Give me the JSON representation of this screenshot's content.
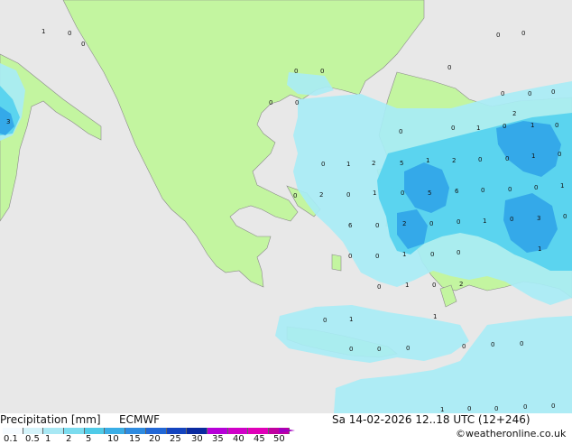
{
  "map": {
    "value_labels": [
      {
        "text": "1"
      },
      {
        "text": "0"
      },
      {
        "text": "0"
      },
      {
        "text": "0"
      },
      {
        "text": "0"
      },
      {
        "text": "0"
      },
      {
        "text": "0"
      },
      {
        "text": "0"
      },
      {
        "text": "0"
      },
      {
        "text": "3"
      },
      {
        "text": "0"
      },
      {
        "text": "0"
      },
      {
        "text": "0"
      },
      {
        "text": "0"
      },
      {
        "text": "0"
      },
      {
        "text": "0"
      },
      {
        "text": "1"
      },
      {
        "text": "0"
      },
      {
        "text": "1"
      },
      {
        "text": "0"
      },
      {
        "text": "2"
      },
      {
        "text": "0"
      },
      {
        "text": "1"
      },
      {
        "text": "2"
      },
      {
        "text": "5"
      },
      {
        "text": "1"
      },
      {
        "text": "2"
      },
      {
        "text": "0"
      },
      {
        "text": "0"
      },
      {
        "text": "1"
      },
      {
        "text": "0"
      },
      {
        "text": "0"
      },
      {
        "text": "2"
      },
      {
        "text": "0"
      },
      {
        "text": "1"
      },
      {
        "text": "0"
      },
      {
        "text": "5"
      },
      {
        "text": "6"
      },
      {
        "text": "0"
      },
      {
        "text": "0"
      },
      {
        "text": "0"
      },
      {
        "text": "1"
      },
      {
        "text": "6"
      },
      {
        "text": "0"
      },
      {
        "text": "2"
      },
      {
        "text": "0"
      },
      {
        "text": "0"
      },
      {
        "text": "1"
      },
      {
        "text": "0"
      },
      {
        "text": "3"
      },
      {
        "text": "0"
      },
      {
        "text": "0"
      },
      {
        "text": "0"
      },
      {
        "text": "1"
      },
      {
        "text": "0"
      },
      {
        "text": "0"
      },
      {
        "text": "1"
      },
      {
        "text": "0"
      },
      {
        "text": "1"
      },
      {
        "text": "0"
      },
      {
        "text": "2"
      },
      {
        "text": "1"
      },
      {
        "text": "1"
      },
      {
        "text": "0"
      },
      {
        "text": "0"
      },
      {
        "text": "0"
      },
      {
        "text": "0"
      },
      {
        "text": "0"
      },
      {
        "text": "0"
      },
      {
        "text": "0"
      },
      {
        "text": "1"
      },
      {
        "text": "0"
      },
      {
        "text": "0"
      },
      {
        "text": "0"
      },
      {
        "text": "0"
      }
    ]
  },
  "footer": {
    "title": "Precipitation [mm]",
    "model": "ECMWF",
    "datetime": "Sa 14-02-2026 12..18 UTC (12+246)",
    "credit": "©weatheronline.co.uk"
  },
  "legend": {
    "ticks": [
      "0.1",
      "0.5",
      "1",
      "2",
      "5",
      "10",
      "15",
      "20",
      "25",
      "30",
      "35",
      "40",
      "45",
      "50"
    ],
    "colors": [
      "#f5fbff",
      "#d4f3fa",
      "#a8e8f4",
      "#7bdcef",
      "#4fcbe8",
      "#3aaee6",
      "#2e8be0",
      "#2167d6",
      "#1444bf",
      "#0a2aa0",
      "#b600d8",
      "#d000c8",
      "#e000b8",
      "#c000a0"
    ]
  },
  "colors": {
    "land": "#c3f5a0",
    "sea": "#e8e8e8",
    "precip_light": "#a8ecf5",
    "precip_mid": "#56d3ee",
    "precip_heavy": "#33a6e8"
  }
}
